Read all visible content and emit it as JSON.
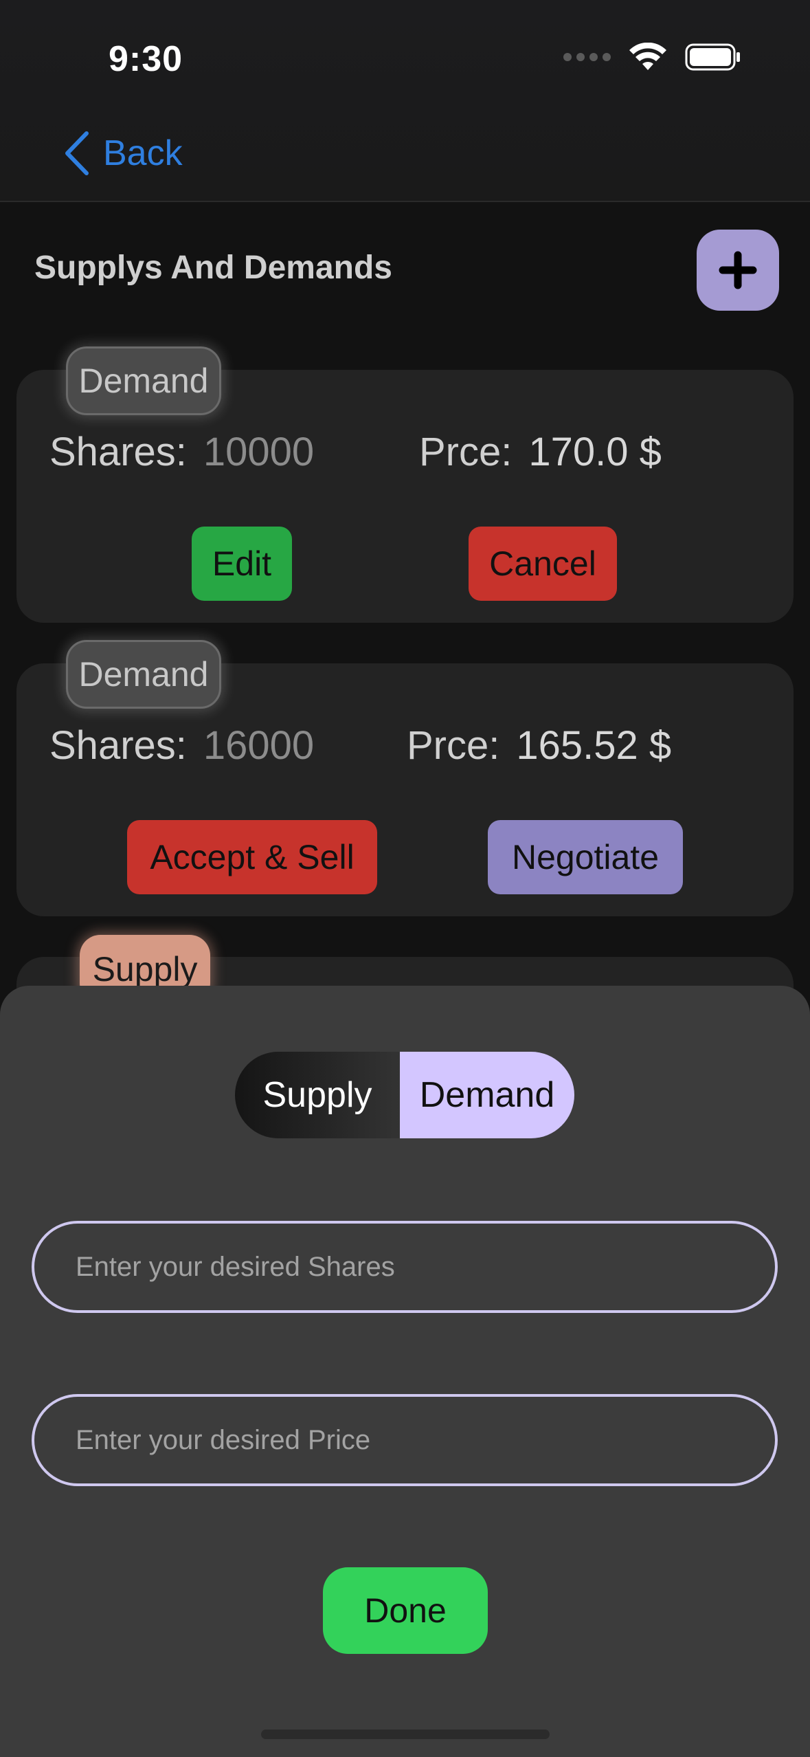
{
  "status_bar": {
    "time": "9:30"
  },
  "nav": {
    "back_label": "Back"
  },
  "header": {
    "title": "Supplys And Demands"
  },
  "cards": [
    {
      "type": "Demand",
      "shares_label": "Shares:",
      "shares": "10000",
      "price_label": "Prce:",
      "price": "170.0 $",
      "primary": "Edit",
      "secondary": "Cancel"
    },
    {
      "type": "Demand",
      "shares_label": "Shares:",
      "shares": "16000",
      "price_label": "Prce:",
      "price": "165.52 $",
      "primary": "Accept & Sell",
      "secondary": "Negotiate"
    },
    {
      "type": "Supply"
    }
  ],
  "sheet": {
    "segment": {
      "options": [
        "Supply",
        "Demand"
      ],
      "selected": "Demand"
    },
    "shares_placeholder": "Enter your desired Shares",
    "price_placeholder": "Enter your desired Price",
    "done_label": "Done"
  },
  "colors": {
    "accent": "#a59bd3",
    "selected_segment": "#d3c6ff",
    "done": "#33d25a",
    "link": "#2f7fe0"
  }
}
